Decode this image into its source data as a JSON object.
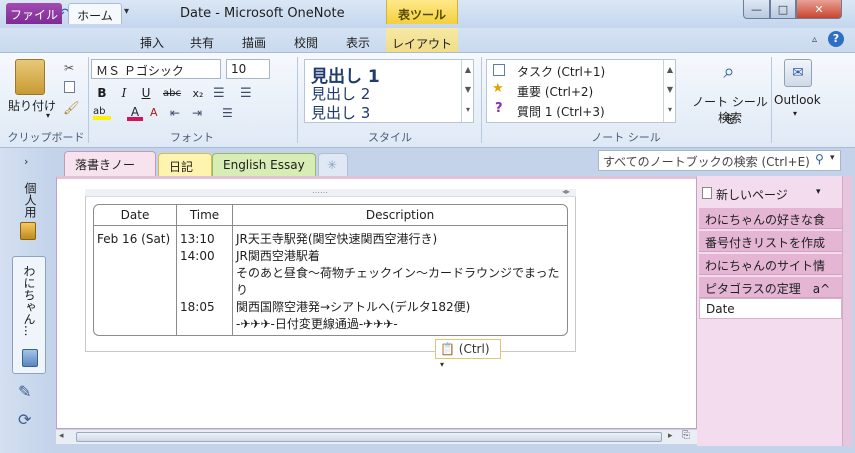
{
  "app": {
    "window_title": "Date - Microsoft OneNote",
    "context_tab_group": "表ツール",
    "icon_name": "onenote-logo-icon"
  },
  "ribbon_tabs": [
    "ファイル",
    "ホーム",
    "挿入",
    "共有",
    "描画",
    "校閲",
    "表示",
    "レイアウト"
  ],
  "clipboard": {
    "paste_label": "貼り付け",
    "group_label": "クリップボード"
  },
  "font": {
    "name": "ＭＳ Ｐゴシック",
    "size": "10",
    "group_label": "フォント",
    "buttons": [
      "B",
      "I",
      "U",
      "abc",
      "x₂"
    ]
  },
  "styles": {
    "items": [
      "見出し 1",
      "見出し 2",
      "見出し 3"
    ],
    "group_label": "スタイル"
  },
  "tags": {
    "items": [
      "タスク (Ctrl+1)",
      "重要 (Ctrl+2)",
      "質問 1 (Ctrl+3)"
    ],
    "group_label": "ノート シール"
  },
  "find_tags": {
    "label_line1": "ノート シールを",
    "label_line2": "検索"
  },
  "outlook": {
    "label": "Outlook"
  },
  "notebooks": {
    "nav_label_1": "個人用",
    "nav_label_2": "わにちゃん..."
  },
  "section_tabs": [
    "落書きノート",
    "日記",
    "English Essay"
  ],
  "search": {
    "placeholder": "すべてのノートブックの検索 (Ctrl+E)"
  },
  "pages": {
    "new_page": "新しいページ",
    "items": [
      "わにちゃんの好きな食",
      "番号付きリストを作成",
      "わにちゃんのサイト情",
      "ピタゴラスの定理　a^",
      "Date"
    ]
  },
  "table": {
    "headers": [
      "Date",
      "Time",
      "Description"
    ],
    "date": "Feb 16 (Sat)",
    "times": [
      "13:10",
      "14:00",
      "",
      "",
      "18:05",
      ""
    ],
    "descriptions": [
      "JR天王寺駅発(関空快速関西空港行き)",
      "JR関西空港駅着",
      "そのあと昼食～荷物チェックイン～カードラウンジでまった",
      "り",
      "関西国際空港発→シアトルへ(デルタ182便)",
      "-✈✈✈-日付変更線通過-✈✈✈-"
    ]
  },
  "paste_options": "(Ctrl)",
  "colors": {
    "file_tab": "#7d2b93",
    "context_tab": "#f3d03e",
    "page_panel": "#f3dced",
    "selected_page": "#ffffff"
  }
}
